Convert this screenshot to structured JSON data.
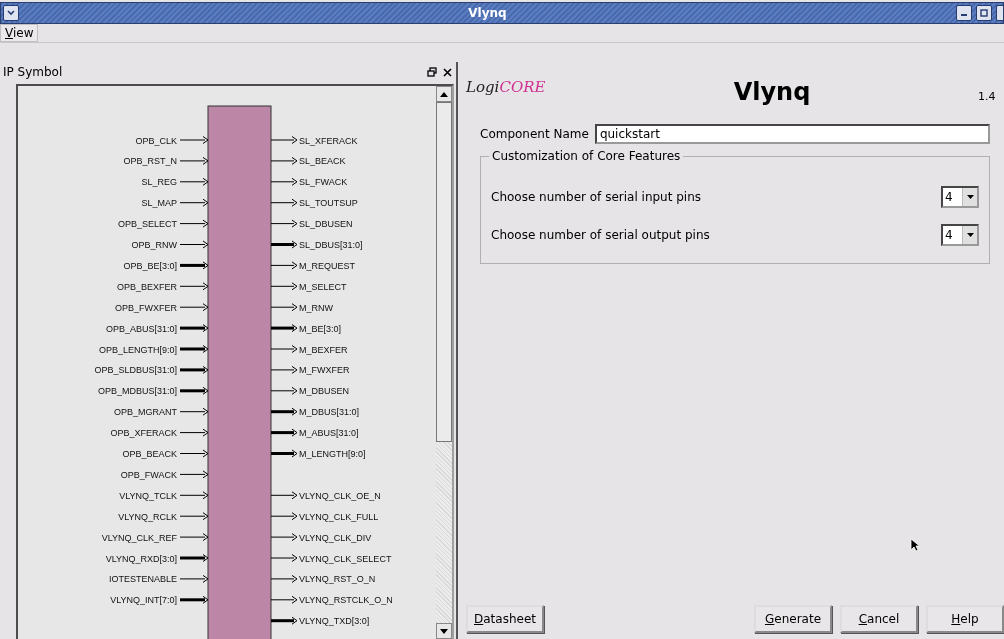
{
  "window": {
    "title": "Vlynq"
  },
  "menu": [
    {
      "label": "View"
    }
  ],
  "left_panel": {
    "title": "IP Symbol",
    "left_pins": [
      {
        "name": "OPB_CLK",
        "bus": false
      },
      {
        "name": "OPB_RST_N",
        "bus": false
      },
      {
        "name": "SL_REG",
        "bus": false
      },
      {
        "name": "SL_MAP",
        "bus": false
      },
      {
        "name": "OPB_SELECT",
        "bus": false
      },
      {
        "name": "OPB_RNW",
        "bus": false
      },
      {
        "name": "OPB_BE[3:0]",
        "bus": true
      },
      {
        "name": "OPB_BEXFER",
        "bus": false
      },
      {
        "name": "OPB_FWXFER",
        "bus": false
      },
      {
        "name": "OPB_ABUS[31:0]",
        "bus": true
      },
      {
        "name": "OPB_LENGTH[9:0]",
        "bus": true
      },
      {
        "name": "OPB_SLDBUS[31:0]",
        "bus": true
      },
      {
        "name": "OPB_MDBUS[31:0]",
        "bus": true
      },
      {
        "name": "OPB_MGRANT",
        "bus": false
      },
      {
        "name": "OPB_XFERACK",
        "bus": false
      },
      {
        "name": "OPB_BEACK",
        "bus": false
      },
      {
        "name": "OPB_FWACK",
        "bus": false
      },
      {
        "name": "VLYNQ_TCLK",
        "bus": false
      },
      {
        "name": "VLYNQ_RCLK",
        "bus": false
      },
      {
        "name": "VLYNQ_CLK_REF",
        "bus": false
      },
      {
        "name": "VLYNQ_RXD[3:0]",
        "bus": true
      },
      {
        "name": "IOTESTENABLE",
        "bus": false
      },
      {
        "name": "VLYNQ_INT[7:0]",
        "bus": true
      }
    ],
    "right_pin_groups": [
      [
        {
          "name": "SL_XFERACK",
          "bus": false
        },
        {
          "name": "SL_BEACK",
          "bus": false
        },
        {
          "name": "SL_FWACK",
          "bus": false
        },
        {
          "name": "SL_TOUTSUP",
          "bus": false
        },
        {
          "name": "SL_DBUSEN",
          "bus": false
        },
        {
          "name": "SL_DBUS[31:0]",
          "bus": true
        },
        {
          "name": "M_REQUEST",
          "bus": false
        },
        {
          "name": "M_SELECT",
          "bus": false
        },
        {
          "name": "M_RNW",
          "bus": false
        },
        {
          "name": "M_BE[3:0]",
          "bus": true
        },
        {
          "name": "M_BEXFER",
          "bus": false
        },
        {
          "name": "M_FWXFER",
          "bus": false
        },
        {
          "name": "M_DBUSEN",
          "bus": false
        },
        {
          "name": "M_DBUS[31:0]",
          "bus": true
        },
        {
          "name": "M_ABUS[31:0]",
          "bus": true
        },
        {
          "name": "M_LENGTH[9:0]",
          "bus": true
        }
      ],
      [
        {
          "name": "VLYNQ_CLK_OE_N",
          "bus": false
        },
        {
          "name": "VLYNQ_CLK_FULL",
          "bus": false
        },
        {
          "name": "VLYNQ_CLK_DIV",
          "bus": false
        },
        {
          "name": "VLYNQ_CLK_SELECT",
          "bus": false
        },
        {
          "name": "VLYNQ_RST_O_N",
          "bus": false
        },
        {
          "name": "VLYNQ_RSTCLK_O_N",
          "bus": false
        },
        {
          "name": "VLYNQ_TXD[3:0]",
          "bus": true
        }
      ]
    ]
  },
  "right_panel": {
    "logo": {
      "prefix": "Logi",
      "suffix": "CORE"
    },
    "title": "Vlynq",
    "version": "1.4",
    "component_name": {
      "label": "Component Name",
      "value": "quickstart"
    },
    "group": {
      "title": "Customization of Core Features",
      "options": [
        {
          "label": "Choose number of serial input pins",
          "value": "4"
        },
        {
          "label": "Choose number of serial output pins",
          "value": "4"
        }
      ]
    },
    "buttons": [
      {
        "label": "Datasheet",
        "kind": "left"
      },
      {
        "label": "Generate",
        "kind": "right"
      },
      {
        "label": "Cancel",
        "kind": "right"
      },
      {
        "label": "Help",
        "kind": "right"
      }
    ]
  }
}
